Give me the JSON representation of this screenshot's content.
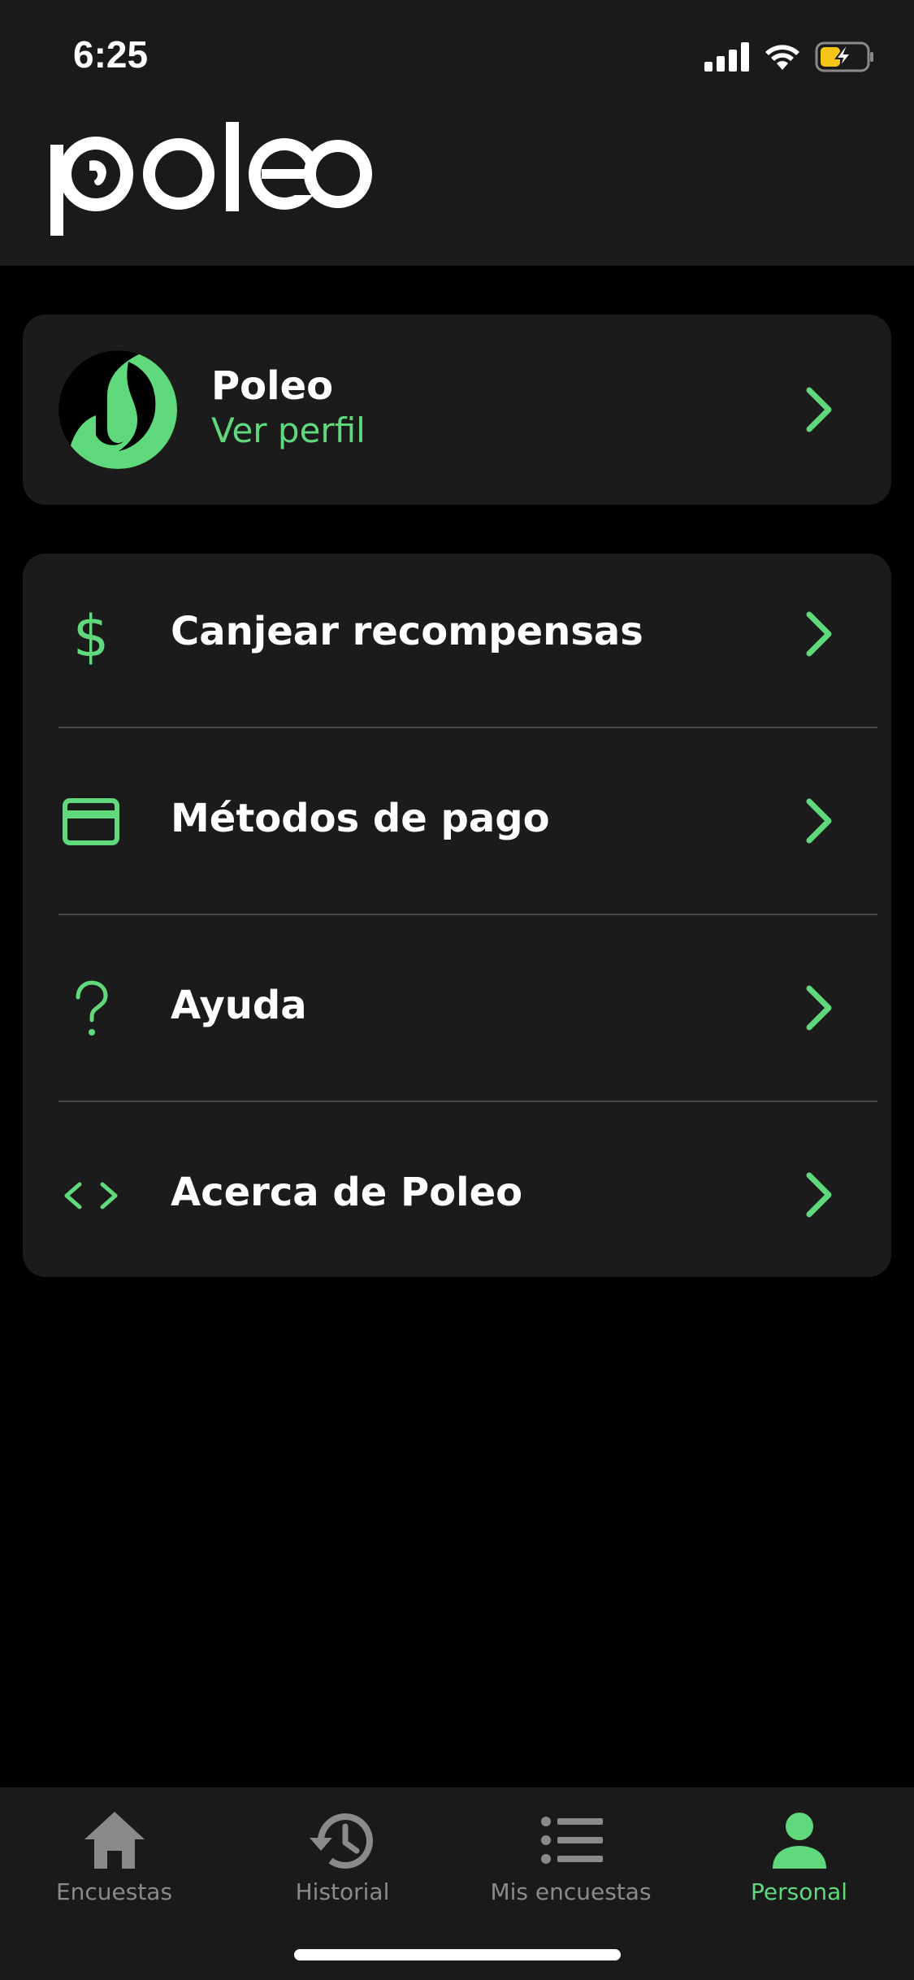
{
  "status_bar": {
    "time": "6:25"
  },
  "header": {
    "logo_text": "poleo"
  },
  "profile": {
    "name": "Poleo",
    "link_label": "Ver perfil"
  },
  "menu": {
    "items": [
      {
        "label": "Canjear recompensas",
        "icon": "dollar-icon"
      },
      {
        "label": "Métodos de pago",
        "icon": "credit-card-icon"
      },
      {
        "label": "Ayuda",
        "icon": "question-icon"
      },
      {
        "label": "Acerca de Poleo",
        "icon": "code-icon"
      }
    ]
  },
  "tabs": [
    {
      "label": "Encuestas",
      "icon": "home-icon",
      "active": false
    },
    {
      "label": "Historial",
      "icon": "history-icon",
      "active": false
    },
    {
      "label": "Mis encuestas",
      "icon": "list-icon",
      "active": false
    },
    {
      "label": "Personal",
      "icon": "person-icon",
      "active": true
    }
  ],
  "colors": {
    "accent": "#5fd97c",
    "background": "#000000",
    "surface": "#1b1b1b",
    "inactive": "#8a8a8a"
  }
}
